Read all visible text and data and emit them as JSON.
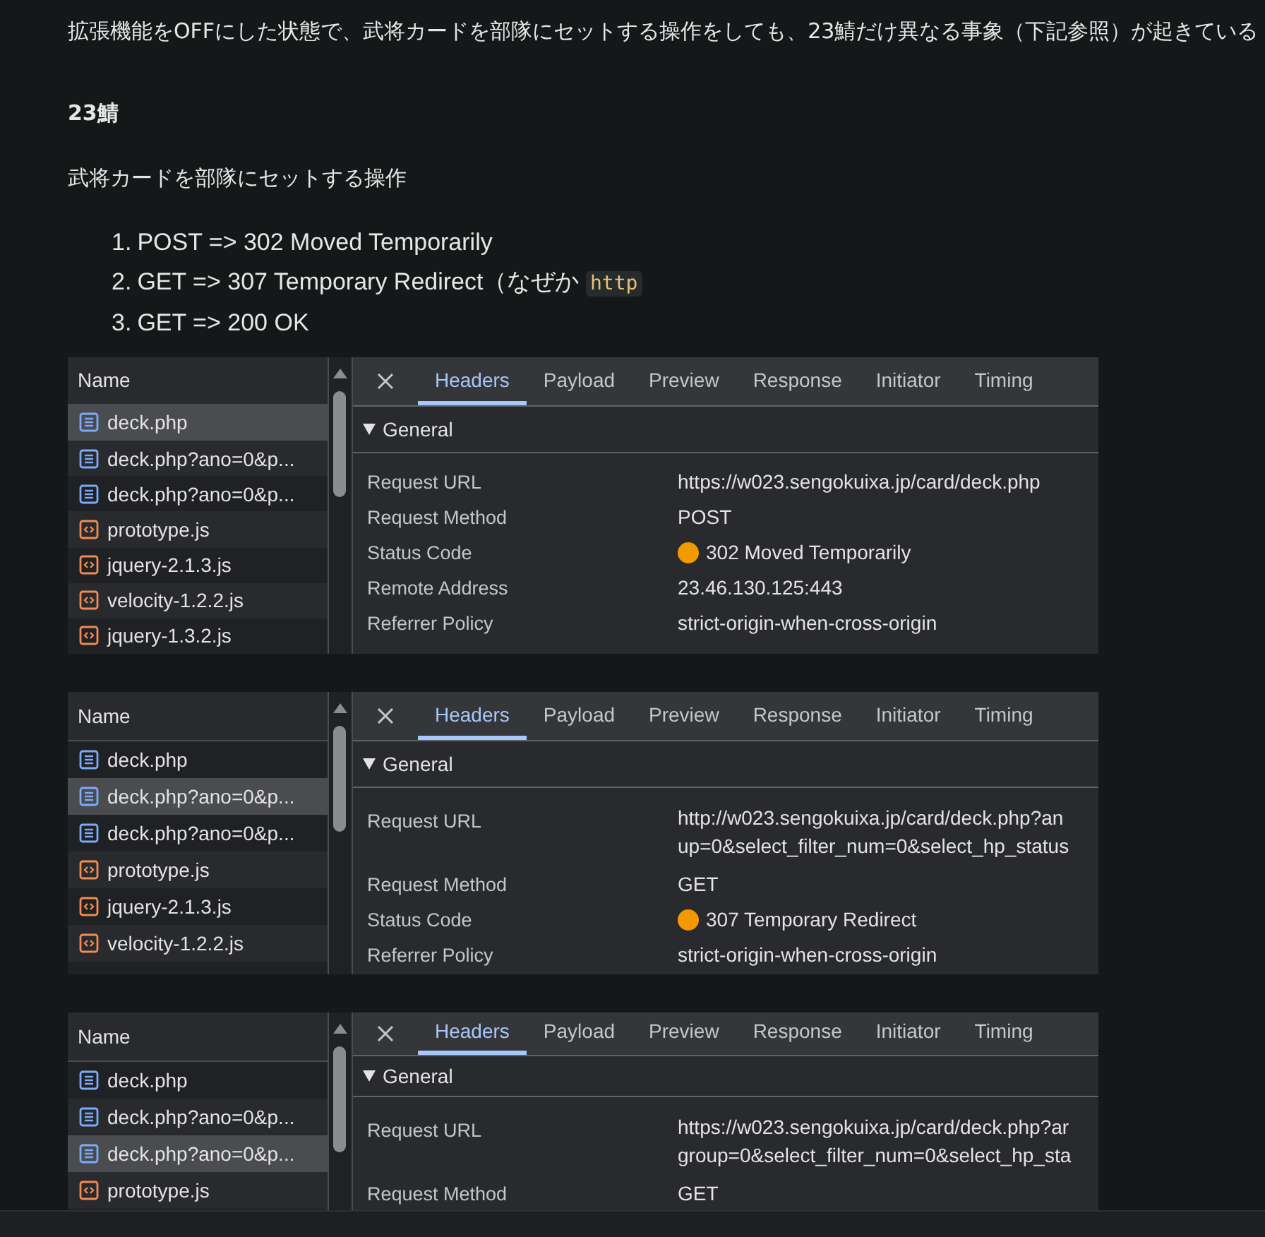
{
  "intro": "拡張機能をOFFにした状態で、武将カードを部隊にセットする操作をしても、23鯖だけ異なる事象（下記参照）が起きている",
  "heading": "23鯖",
  "subheading": "武将カードを部隊にセットする操作",
  "steps": [
    {
      "number": "1.",
      "text": "POST => 302 Moved Temporarily"
    },
    {
      "number": "2.",
      "text": "GET => 307 Temporary Redirect（なぜか",
      "code": "http"
    },
    {
      "number": "3.",
      "text": "GET => 200 OK"
    }
  ],
  "panels": [
    {
      "column": "Name",
      "files": [
        {
          "name": "deck.php",
          "kind": "document",
          "selected": true
        },
        {
          "name": "deck.php?ano=0&p...",
          "kind": "document",
          "selected": false
        },
        {
          "name": "deck.php?ano=0&p...",
          "kind": "document",
          "selected": false
        },
        {
          "name": "prototype.js",
          "kind": "script",
          "selected": false
        },
        {
          "name": "jquery-2.1.3.js",
          "kind": "script",
          "selected": false
        },
        {
          "name": "velocity-1.2.2.js",
          "kind": "script",
          "selected": false
        },
        {
          "name": "jquery-1.3.2.js",
          "kind": "script",
          "selected": false
        }
      ],
      "tabs": [
        {
          "label": "Headers",
          "selected": true
        },
        {
          "label": "Payload",
          "selected": false
        },
        {
          "label": "Preview",
          "selected": false
        },
        {
          "label": "Response",
          "selected": false
        },
        {
          "label": "Initiator",
          "selected": false
        },
        {
          "label": "Timing",
          "selected": false
        }
      ],
      "section": {
        "title": "General",
        "expanded": true
      },
      "headers": [
        {
          "label": "Request URL",
          "value": [
            "https://w023.sengokuixa.jp/card/deck.php"
          ]
        },
        {
          "label": "Request Method",
          "value": [
            "POST"
          ]
        },
        {
          "label": "Status Code",
          "value": [
            "302 Moved Temporarily"
          ],
          "color": "#f29900"
        },
        {
          "label": "Remote Address",
          "value": [
            "23.46.130.125:443"
          ]
        },
        {
          "label": "Referrer Policy",
          "value": [
            "strict-origin-when-cross-origin"
          ]
        }
      ]
    },
    {
      "column": "Name",
      "files": [
        {
          "name": "deck.php",
          "kind": "document",
          "selected": false
        },
        {
          "name": "deck.php?ano=0&p...",
          "kind": "document",
          "selected": true
        },
        {
          "name": "deck.php?ano=0&p...",
          "kind": "document",
          "selected": false
        },
        {
          "name": "prototype.js",
          "kind": "script",
          "selected": false
        },
        {
          "name": "jquery-2.1.3.js",
          "kind": "script",
          "selected": false
        },
        {
          "name": "velocity-1.2.2.js",
          "kind": "script",
          "selected": false
        }
      ],
      "tabs": [
        {
          "label": "Headers",
          "selected": true
        },
        {
          "label": "Payload",
          "selected": false
        },
        {
          "label": "Preview",
          "selected": false
        },
        {
          "label": "Response",
          "selected": false
        },
        {
          "label": "Initiator",
          "selected": false
        },
        {
          "label": "Timing",
          "selected": false
        }
      ],
      "section": {
        "title": "General",
        "expanded": true
      },
      "headers": [
        {
          "label": "Request URL",
          "value": [
            "http://w023.sengokuixa.jp/card/deck.php?an",
            "up=0&select_filter_num=0&select_hp_status"
          ]
        },
        {
          "label": "Request Method",
          "value": [
            "GET"
          ]
        },
        {
          "label": "Status Code",
          "value": [
            "307 Temporary Redirect"
          ],
          "color": "#f29900"
        },
        {
          "label": "Referrer Policy",
          "value": [
            "strict-origin-when-cross-origin"
          ]
        }
      ]
    },
    {
      "column": "Name",
      "files": [
        {
          "name": "deck.php",
          "kind": "document",
          "selected": false
        },
        {
          "name": "deck.php?ano=0&p...",
          "kind": "document",
          "selected": false
        },
        {
          "name": "deck.php?ano=0&p...",
          "kind": "document",
          "selected": true
        },
        {
          "name": "prototype.js",
          "kind": "script",
          "selected": false
        }
      ],
      "tabs": [
        {
          "label": "Headers",
          "selected": true
        },
        {
          "label": "Payload",
          "selected": false
        },
        {
          "label": "Preview",
          "selected": false
        },
        {
          "label": "Response",
          "selected": false
        },
        {
          "label": "Initiator",
          "selected": false
        },
        {
          "label": "Timing",
          "selected": false
        }
      ],
      "section": {
        "title": "General",
        "expanded": true
      },
      "headers": [
        {
          "label": "Request URL",
          "value": [
            "https://w023.sengokuixa.jp/card/deck.php?ar",
            "group=0&select_filter_num=0&select_hp_sta"
          ]
        },
        {
          "label": "Request Method",
          "value": [
            "GET"
          ]
        }
      ]
    }
  ]
}
